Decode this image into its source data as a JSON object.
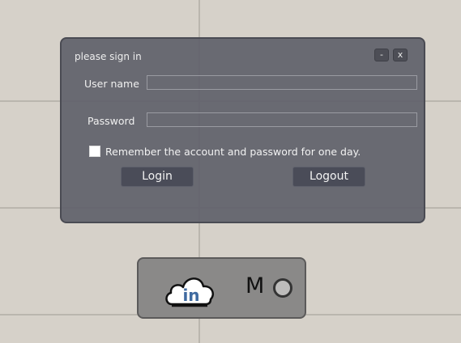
{
  "dialog": {
    "title": "please sign in",
    "minimize_label": "-",
    "close_label": "x",
    "username_label": "User name",
    "username_value": "",
    "password_label": "Password",
    "password_value": "",
    "remember_label": "Remember the account and password for one day.",
    "remember_checked": false,
    "login_label": "Login",
    "logout_label": "Logout"
  },
  "status": {
    "cloud_icon_text": "in",
    "mode_text": "M",
    "indicator": "status-indicator-icon"
  },
  "colors": {
    "desktop_background": "#d6d1c9",
    "dialog_background": "#60616a",
    "button_background": "#4a4c58",
    "status_background": "#8a8988",
    "cloud_text": "#3f6aa0"
  }
}
